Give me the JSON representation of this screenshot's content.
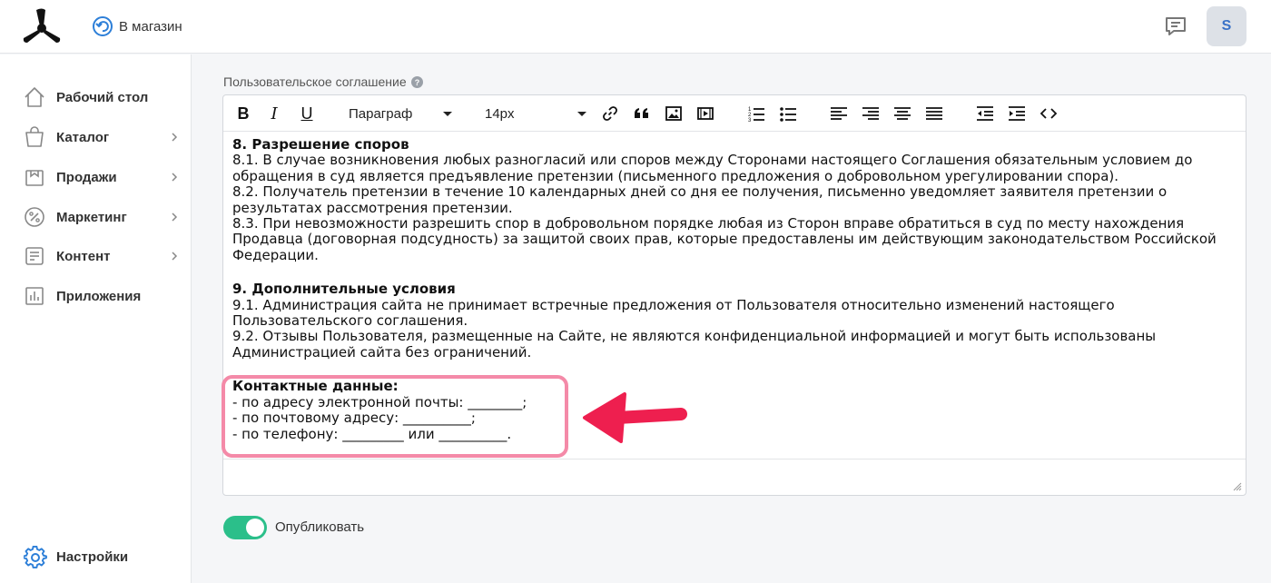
{
  "header": {
    "back_label": "В магазин",
    "avatar_letter": "S"
  },
  "sidebar": {
    "items": [
      {
        "label": "Рабочий стол",
        "icon": "home-icon",
        "has_chevron": false
      },
      {
        "label": "Каталог",
        "icon": "bag-icon",
        "has_chevron": true
      },
      {
        "label": "Продажи",
        "icon": "sales-icon",
        "has_chevron": true
      },
      {
        "label": "Маркетинг",
        "icon": "percent-icon",
        "has_chevron": true
      },
      {
        "label": "Контент",
        "icon": "document-icon",
        "has_chevron": true
      },
      {
        "label": "Приложения",
        "icon": "apps-chart-icon",
        "has_chevron": false
      }
    ],
    "settings_label": "Настройки"
  },
  "editor": {
    "field_label": "Пользовательское соглашение",
    "toolbar": {
      "bold": "B",
      "italic": "I",
      "underline": "U",
      "format_select": "Параграф",
      "size_select": "14px"
    },
    "content": {
      "s8_title": "8. Разрешение споров",
      "s8_1": "8.1. В случае возникновения любых разногласий или споров между Сторонами настоящего Соглашения обязательным условием до обращения в суд является предъявление претензии (письменного предложения о добровольном урегулировании спора).",
      "s8_2": "8.2. Получатель претензии в течение 10 календарных дней со дня ее получения, письменно уведомляет заявителя претензии о результатах рассмотрения претензии.",
      "s8_3": "8.3. При невозможности разрешить спор в добровольном порядке любая из Сторон вправе обратиться в суд по месту нахождения Продавца (договорная подсудность) за защитой своих прав, которые предоставлены им действующим законодательством Российской Федерации.",
      "s9_title": "9. Дополнительные условия",
      "s9_1": "9.1. Администрация сайта не принимает встречные предложения от Пользователя относительно изменений настоящего Пользовательского соглашения.",
      "s9_2": "9.2. Отзывы Пользователя, размещенные на Сайте, не являются конфиденциальной информацией и могут быть использованы Администрацией сайта без ограничений.",
      "contacts_title": "Контактные данные:",
      "contact_email": "- по адресу электронной почты: ________;",
      "contact_post": "- по почтовому адресу: __________;",
      "contact_phone": "- по телефону: _________ или __________."
    }
  },
  "publish": {
    "label": "Опубликовать",
    "enabled": true
  },
  "colors": {
    "accent_blue": "#2d7fd8",
    "toggle_green": "#2bbf8a",
    "highlight_pink": "#f48aa8",
    "arrow_red": "#ee1f4f"
  }
}
